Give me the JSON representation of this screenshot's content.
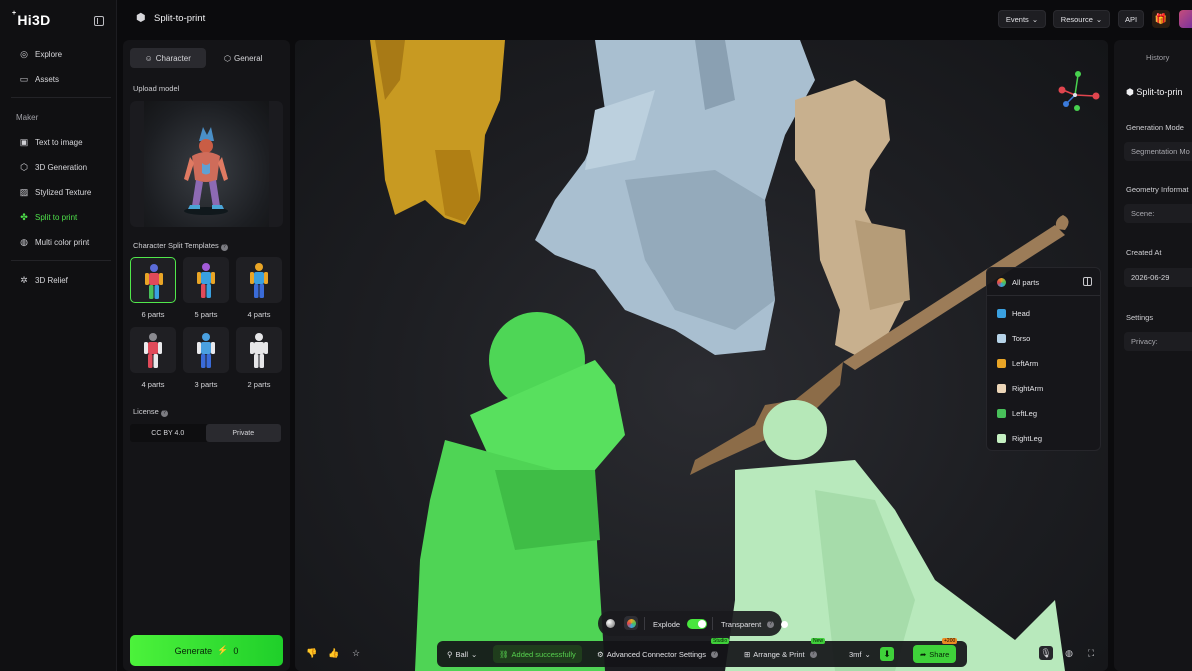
{
  "app": {
    "logo": "Hi3D",
    "logo_mark": "+"
  },
  "nav": {
    "items": [
      {
        "label": "Explore"
      },
      {
        "label": "Assets"
      }
    ],
    "section_label": "Maker",
    "maker_items": [
      {
        "label": "Text to image"
      },
      {
        "label": "3D Generation"
      },
      {
        "label": "Stylized Texture"
      },
      {
        "label": "Split to print",
        "active": true
      },
      {
        "label": "Multi color print"
      }
    ],
    "extra_items": [
      {
        "label": "3D Relief"
      }
    ]
  },
  "topbar": {
    "title": "Split-to-print",
    "events": "Events",
    "resource": "Resource",
    "api": "API"
  },
  "left_panel": {
    "tabs": [
      "Character",
      "General"
    ],
    "active_tab": "Character",
    "upload_label": "Upload model",
    "templates_title": "Character Split Templates",
    "templates": [
      {
        "label": "6 parts",
        "selected": true
      },
      {
        "label": "5 parts"
      },
      {
        "label": "4 parts"
      },
      {
        "label": "4 parts"
      },
      {
        "label": "3 parts"
      },
      {
        "label": "2 parts"
      }
    ],
    "license_title": "License",
    "license_options": [
      "CC BY 4.0",
      "Private"
    ],
    "license_selected": "Private",
    "generate_label": "Generate",
    "generate_cost": "0"
  },
  "parts_panel": {
    "all_label": "All parts",
    "parts": [
      {
        "label": "Head",
        "color": "#3aa0e0"
      },
      {
        "label": "Torso",
        "color": "#b6d3e8"
      },
      {
        "label": "LeftArm",
        "color": "#e9a526"
      },
      {
        "label": "RightArm",
        "color": "#ecd6b8"
      },
      {
        "label": "LeftLeg",
        "color": "#48c05a"
      },
      {
        "label": "RightLeg",
        "color": "#c5f0c2"
      }
    ]
  },
  "view_controls": {
    "explode_label": "Explode",
    "explode_on": true,
    "transparent_label": "Transparent"
  },
  "bottom_bar": {
    "ball_label": "Ball",
    "added_label": "Added successfully",
    "connector_label": "Advanced Connector Settings",
    "connector_badge": "Studio",
    "arrange_label": "Arrange & Print",
    "arrange_badge": "New",
    "format_label": "3mf",
    "share_label": "Share",
    "share_badge": "+200"
  },
  "right_panel": {
    "tab": "History",
    "title": "Split-to-prin",
    "generation_mode_label": "Generation Mode",
    "generation_mode_value": "Segmentation Mo",
    "geometry_label": "Geometry Informat",
    "scene_label": "Scene:",
    "created_label": "Created At",
    "created_value": "2026-06-29",
    "settings_label": "Settings",
    "privacy_label": "Privacy:"
  }
}
